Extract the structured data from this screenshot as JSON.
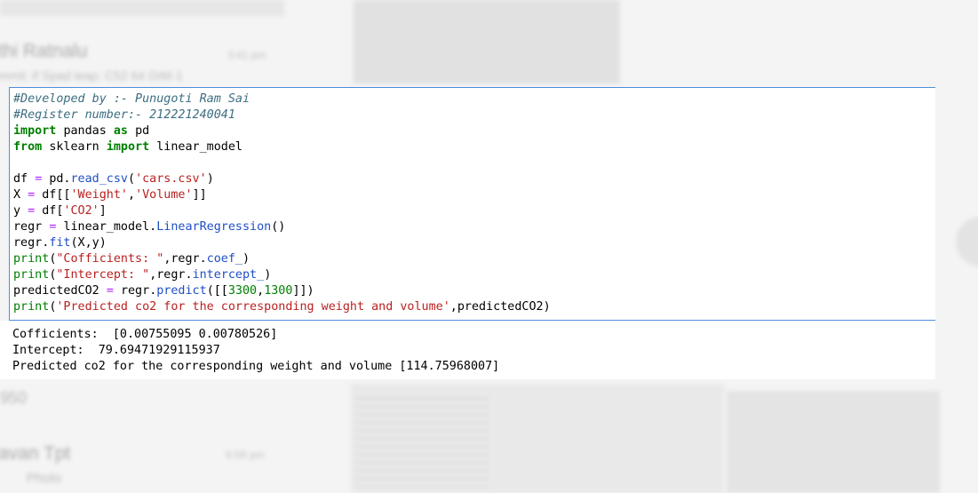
{
  "background": {
    "chat_name_1": "thi Ratnalu",
    "chat_time_1": "3:41 pm",
    "chat_preview_1": "mmit: if Spad leap: C52 64 GIM-1",
    "chat_num": "950",
    "chat_name_2": "avan Tpt",
    "chat_time_2": "6:59 pm",
    "chat_preview_2": "Photo"
  },
  "code": {
    "comment_dev": "#Developed by :- Punugoti Ram Sai",
    "comment_reg": "#Register number:- 212221240041",
    "kw_import": "import",
    "kw_as": "as",
    "kw_from": "from",
    "mod_pandas": "pandas",
    "alias_pd": "pd",
    "mod_sklearn": "sklearn",
    "name_linear_model": "linear_model",
    "var_df": "df",
    "var_X": "X",
    "var_y": "y",
    "var_regr": "regr",
    "var_predicted": "predictedCO2",
    "eq": "=",
    "pd_prefix": "pd.",
    "fn_read_csv": "read_csv",
    "str_cars": "'cars.csv'",
    "str_weight": "'Weight'",
    "str_volume": "'Volume'",
    "str_co2": "'CO2'",
    "lm_prefix": "linear_model.",
    "fn_linreg": "LinearRegression",
    "fn_fit": "fit",
    "fn_predict": "predict",
    "fn_coef": "coef_",
    "fn_intercept": "intercept_",
    "fn_print": "print",
    "str_coef": "\"Cofficients: \"",
    "str_intercept": "\"Intercept: \"",
    "str_predicted": "'Predicted co2 for the corresponding weight and volume'",
    "num_3300": "3300",
    "num_1300": "1300"
  },
  "output": {
    "line_1": "Cofficients:  [0.00755095 0.00780526]",
    "line_2": "Intercept:  79.69471929115937",
    "line_3": "Predicted co2 for the corresponding weight and volume [114.75968007]"
  }
}
